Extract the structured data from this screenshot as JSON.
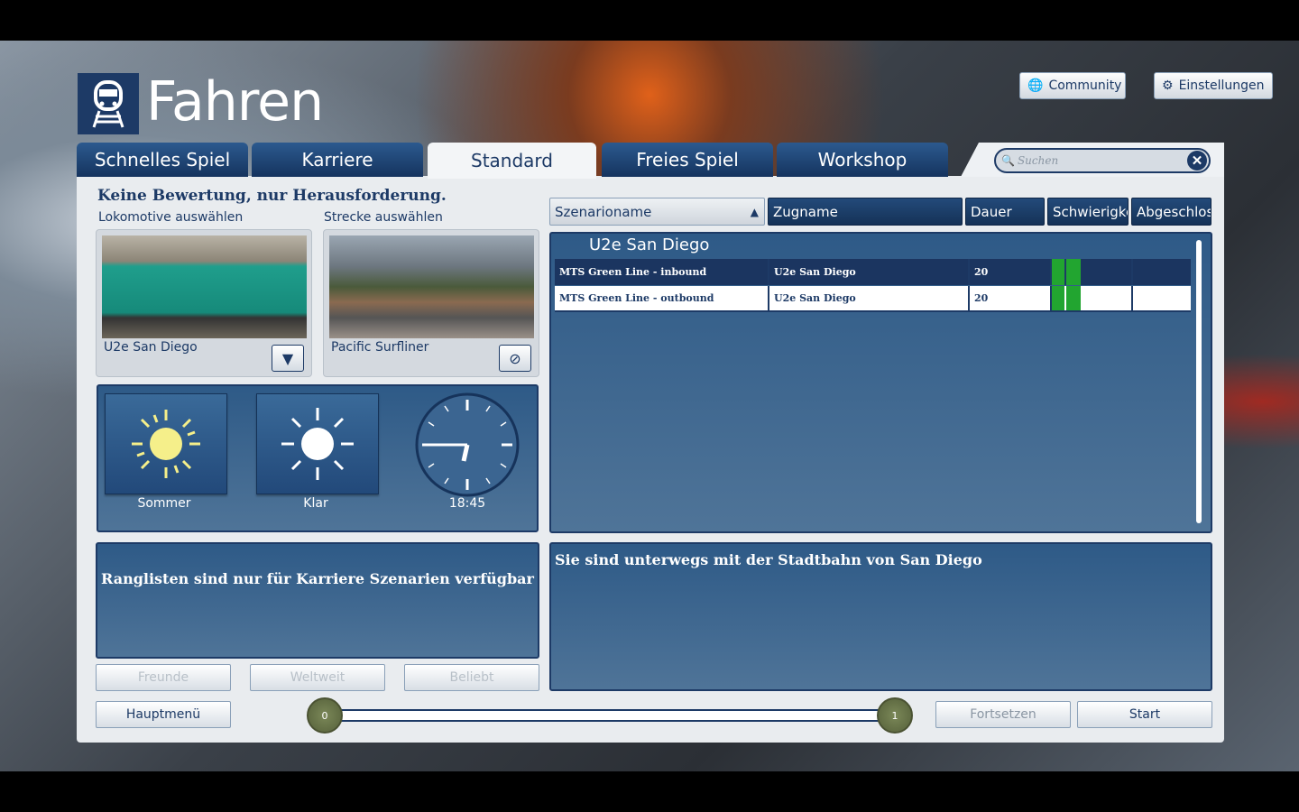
{
  "header": {
    "title": "Fahren",
    "community": "Community",
    "settings": "Einstellungen"
  },
  "tabs": [
    "Schnelles Spiel",
    "Karriere",
    "Standard",
    "Freies Spiel",
    "Workshop"
  ],
  "search": {
    "placeholder": "Suchen"
  },
  "left": {
    "heading": "Keine Bewertung, nur Herausforderung.",
    "loco_label": "Lokomotive auswählen",
    "route_label": "Strecke auswählen",
    "loco_name": "U2e San Diego",
    "route_name": "Pacific Surfliner"
  },
  "conditions": {
    "season": "Sommer",
    "weather": "Klar",
    "time": "18:45"
  },
  "rankings": {
    "message": "Ranglisten sind nur für Karriere Szenarien verfügbar",
    "buttons": [
      "Freunde",
      "Weltweit",
      "Beliebt"
    ]
  },
  "table": {
    "headers": [
      "Szenarioname",
      "Zugname",
      "Dauer",
      "Schwierigke",
      "Abgeschlos"
    ],
    "group": "U2e San Diego",
    "rows": [
      {
        "name": "MTS Green Line - inbound",
        "train": "U2e San Diego",
        "duration": "20",
        "difficulty": 2
      },
      {
        "name": "MTS Green Line - outbound",
        "train": "U2e San Diego",
        "duration": "20",
        "difficulty": 2
      }
    ]
  },
  "description": "Sie sind unterwegs mit der Stadtbahn von San Diego",
  "footer": {
    "main_menu": "Hauptmenü",
    "slider_min": "0",
    "slider_max": "1",
    "continue": "Fortsetzen",
    "start": "Start"
  }
}
